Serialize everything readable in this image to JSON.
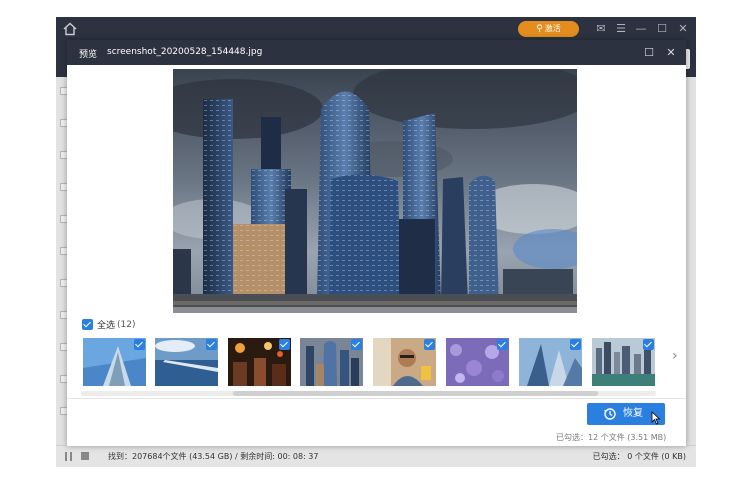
{
  "app": {
    "activate_label": "激活",
    "status_found": "找到：207684个文件 (43.54 GB) / 剩余时间:   00: 08: 37",
    "status_selected": "已勾选：  0 个文件 (0 KB)"
  },
  "dialog": {
    "title_label": "预览",
    "filename": "screenshot_20200528_154448.jpg",
    "select_all_label": "全选",
    "select_all_count": "(12)",
    "recover_label": "恢复",
    "selected_info": "已勾选：12 个文件 (3.51 MB)",
    "thumbnails": [
      {
        "subject": "skyscraper-sky",
        "checked": true
      },
      {
        "subject": "pier-sea",
        "checked": true
      },
      {
        "subject": "night-market",
        "checked": true
      },
      {
        "subject": "city-towers",
        "checked": true
      },
      {
        "subject": "man-with-glasses",
        "checked": true
      },
      {
        "subject": "purple-flowers",
        "checked": true
      },
      {
        "subject": "glass-towers-sky",
        "checked": true
      },
      {
        "subject": "waterfront-skyline",
        "checked": true
      }
    ]
  },
  "colors": {
    "accent": "#2b7fe0",
    "titlebar": "#2c3240",
    "activate": "#e38d1e"
  }
}
